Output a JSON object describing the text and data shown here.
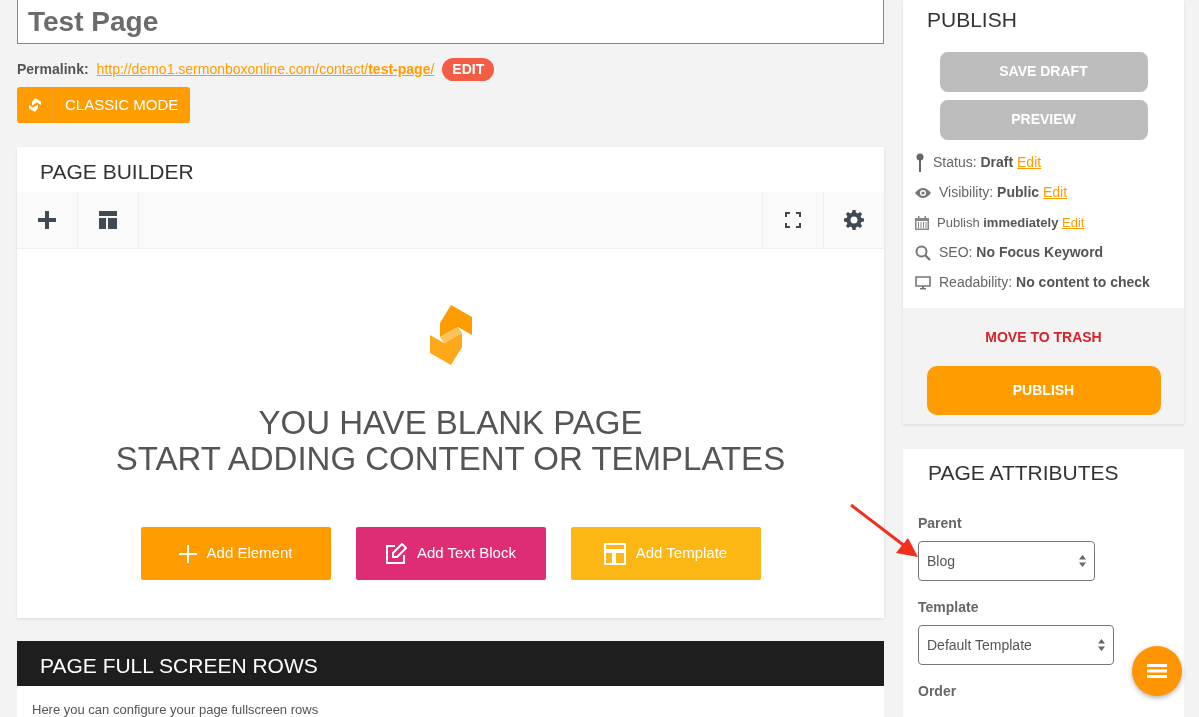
{
  "title_field": {
    "value": "Test Page"
  },
  "permalink": {
    "label": "Permalink:",
    "url": "http://demo1.sermonboxonline.com/contact/**test-page**/",
    "edit_button": "EDIT"
  },
  "classic_mode_button": "CLASSIC MODE",
  "page_builder": {
    "title": "PAGE BUILDER",
    "message": [
      "YOU HAVE BLANK PAGE",
      "START ADDING CONTENT OR TEMPLATES"
    ],
    "actions": [
      {
        "kind": "element",
        "label": "Add Element",
        "color": "#ff9c00"
      },
      {
        "kind": "text",
        "label": "Add Text Block",
        "color": "#de2d74"
      },
      {
        "kind": "template",
        "label": "Add Template",
        "color": "#fdb714"
      }
    ]
  },
  "fullscreen_rows": {
    "title": "PAGE FULL SCREEN ROWS",
    "description": "Here you can configure your page fullscreen rows"
  },
  "publish": {
    "title": "PUBLISH",
    "buttons": [
      {
        "label": "SAVE DRAFT",
        "disabled": true
      },
      {
        "label": "PREVIEW",
        "disabled": true
      }
    ],
    "meta": [
      {
        "kind": "status",
        "text": "Status: **Draft**",
        "link": "Edit"
      },
      {
        "kind": "visibility",
        "text": "Visibility: **Public**",
        "link": "Edit"
      },
      {
        "kind": "schedule",
        "text": "Publish **immediately**",
        "link": "Edit"
      },
      {
        "kind": "seo",
        "text": "SEO: **No Focus Keyword**"
      },
      {
        "kind": "readability",
        "text": "Readability: **No content to check**"
      }
    ],
    "trash_link": "MOVE TO TRASH",
    "publish_button": "PUBLISH"
  },
  "page_attributes": {
    "title": "PAGE ATTRIBUTES",
    "fields": [
      {
        "label": "Parent",
        "value": "Blog"
      },
      {
        "label": "Template",
        "value": "Default Template"
      },
      {
        "label": "Order"
      }
    ]
  }
}
